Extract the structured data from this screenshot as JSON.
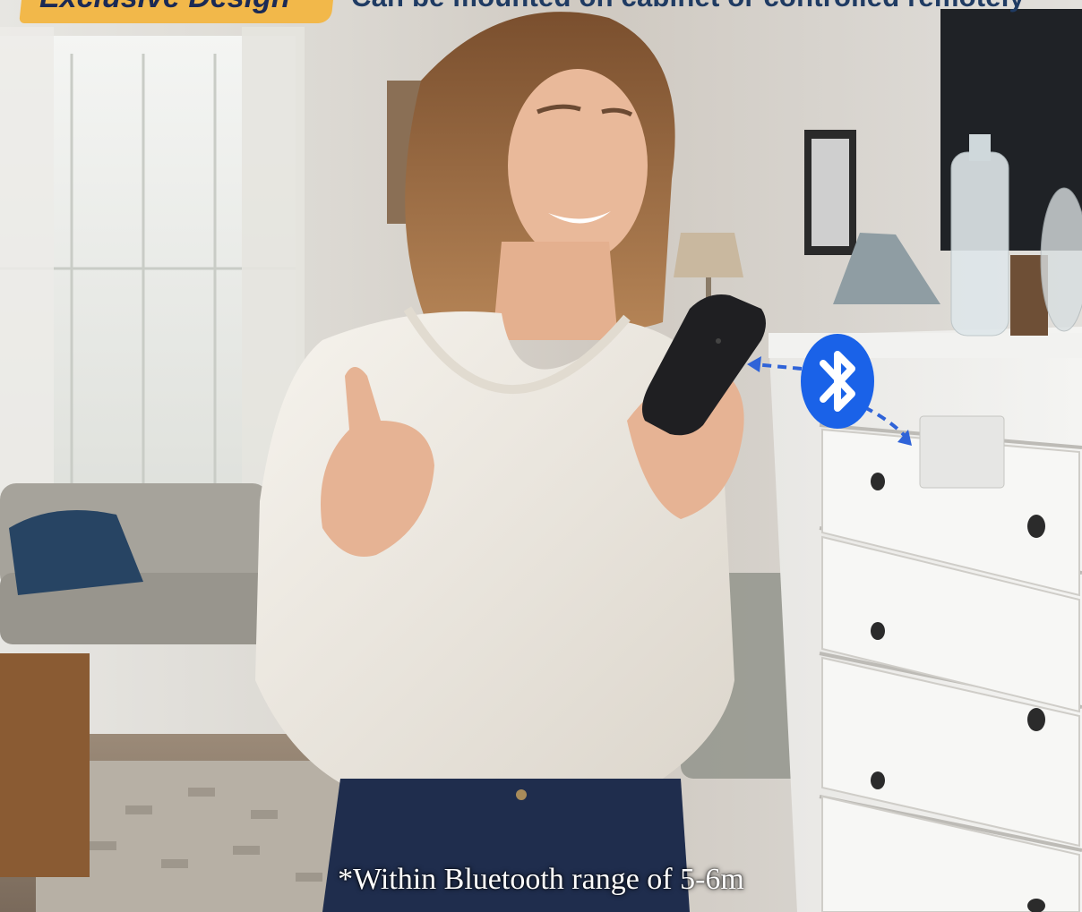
{
  "banner": {
    "tag_text": "Exclusive Design",
    "caption_text": "Can be mounted on cabinet or controlled remotely"
  },
  "caption": {
    "text": "*Within Bluetooth range of 5-6m"
  },
  "icons": {
    "bluetooth": "bluetooth-icon"
  },
  "colors": {
    "banner_tag": "#f2b84a",
    "bluetooth_blue": "#1a62e8",
    "arrow": "#2f63d8",
    "caption_text": "#ffffff"
  }
}
